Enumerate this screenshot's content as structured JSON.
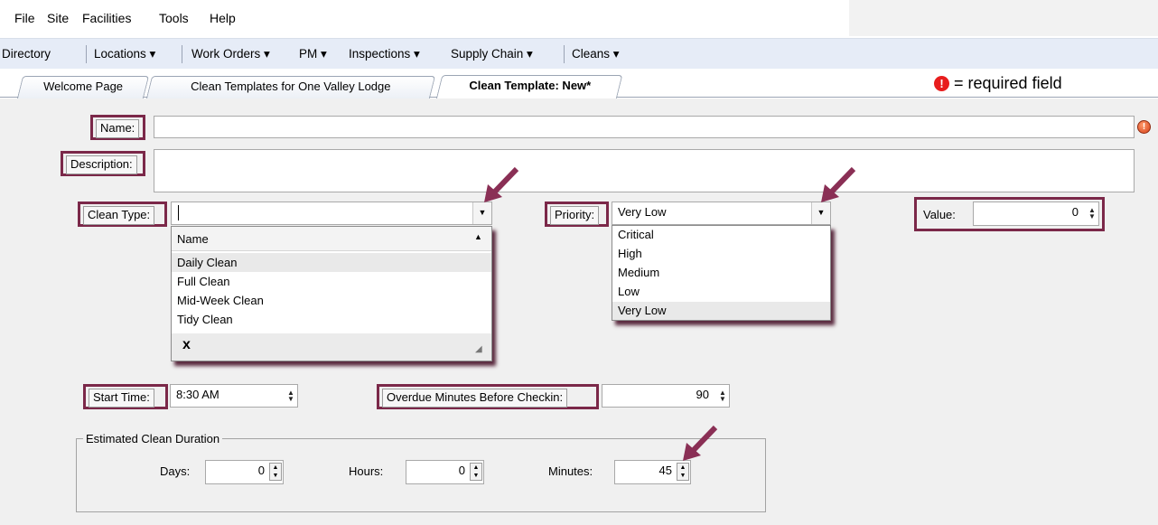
{
  "menu": {
    "items": [
      "File",
      "Site",
      "Facilities",
      "Tools",
      "Help"
    ]
  },
  "nav": {
    "items": [
      "Directory",
      "Locations ▾",
      "Work Orders ▾",
      "PM ▾",
      "Inspections ▾",
      "Supply Chain ▾",
      "Cleans ▾"
    ]
  },
  "tabs": {
    "items": [
      "Welcome Page",
      "Clean Templates for One Valley Lodge",
      "Clean Template: New*"
    ],
    "active_index": 2
  },
  "legend_note": {
    "icon": "required-field-icon",
    "text": "= required field"
  },
  "form": {
    "name": {
      "label": "Name:",
      "value": ""
    },
    "description": {
      "label": "Description:",
      "value": ""
    },
    "clean_type": {
      "label": "Clean Type:",
      "value": "",
      "dropdown": {
        "header": "Name",
        "options": [
          "Daily Clean",
          "Full Clean",
          "Mid-Week Clean",
          "Tidy Clean"
        ],
        "highlighted": "Daily Clean",
        "clear_label": "x"
      }
    },
    "priority": {
      "label": "Priority:",
      "value": "Very Low",
      "dropdown": {
        "options": [
          "Critical",
          "High",
          "Medium",
          "Low",
          "Very Low"
        ],
        "highlighted": "Very Low"
      }
    },
    "value_field": {
      "label": "Value:",
      "value": "0"
    },
    "start_time": {
      "label": "Start Time:",
      "value": "8:30 AM"
    },
    "overdue": {
      "label": "Overdue Minutes Before Checkin:",
      "value": "90"
    },
    "duration": {
      "legend": "Estimated Clean Duration",
      "days": {
        "label": "Days:",
        "value": "0"
      },
      "hours": {
        "label": "Hours:",
        "value": "0"
      },
      "minutes": {
        "label": "Minutes:",
        "value": "45"
      }
    }
  },
  "colors": {
    "highlight_border": "#7b2849",
    "arrow": "#8a2f55",
    "required": "#e81d1d",
    "navbar_bg": "#e6ecf7",
    "form_bg": "#f0f0f0"
  }
}
